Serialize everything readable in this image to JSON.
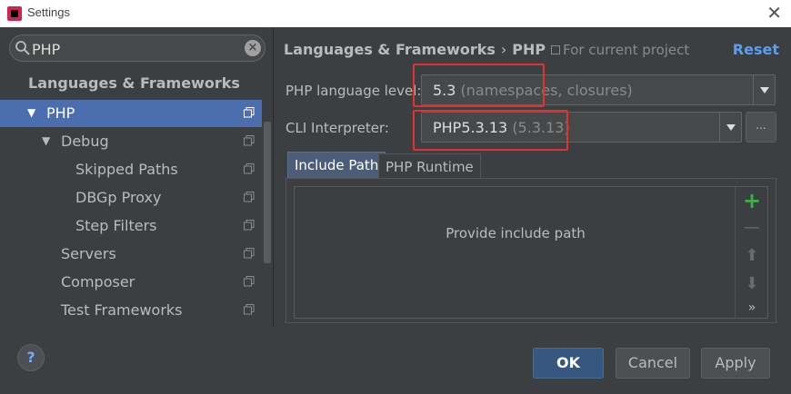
{
  "window": {
    "title": "Settings",
    "close_glyph": "✕"
  },
  "search": {
    "value": "PHP",
    "placeholder": "",
    "clear_glyph": "×"
  },
  "sidebar": {
    "section_title": "Languages & Frameworks",
    "items": [
      {
        "label": "PHP",
        "arrow": "▼",
        "selected": true
      },
      {
        "label": "Debug",
        "arrow": "▼",
        "selected": false
      },
      {
        "label": "Skipped Paths",
        "arrow": "",
        "selected": false
      },
      {
        "label": "DBGp Proxy",
        "arrow": "",
        "selected": false
      },
      {
        "label": "Step Filters",
        "arrow": "",
        "selected": false
      },
      {
        "label": "Servers",
        "arrow": "",
        "selected": false
      },
      {
        "label": "Composer",
        "arrow": "",
        "selected": false
      },
      {
        "label": "Test Frameworks",
        "arrow": "",
        "selected": false
      }
    ]
  },
  "header": {
    "breadcrumb_parent": "Languages & Frameworks",
    "breadcrumb_separator": "›",
    "breadcrumb_current": "PHP",
    "scope": "For current project",
    "reset": "Reset"
  },
  "php_language_level": {
    "label": "PHP language level:",
    "value": "5.3",
    "detail": "(namespaces, closures)"
  },
  "cli_interpreter": {
    "label": "CLI Interpreter:",
    "value": "PHP5.3.13",
    "detail": "(5.3.13)",
    "more_label": "..."
  },
  "tabs": [
    {
      "label": "Include Path",
      "active": true
    },
    {
      "label": "PHP Runtime",
      "active": false
    }
  ],
  "include_path": {
    "empty_text": "Provide include path",
    "tools": {
      "add": "+",
      "remove": "—",
      "up": "⬆",
      "down": "⬇",
      "more": "»"
    }
  },
  "footer": {
    "help": "?",
    "ok": "OK",
    "cancel": "Cancel",
    "apply": "Apply"
  },
  "colors": {
    "background": "#3c3f41",
    "selection": "#4b6eaf",
    "link": "#589df6",
    "highlight": "#e53030",
    "add": "#3fae4b"
  }
}
